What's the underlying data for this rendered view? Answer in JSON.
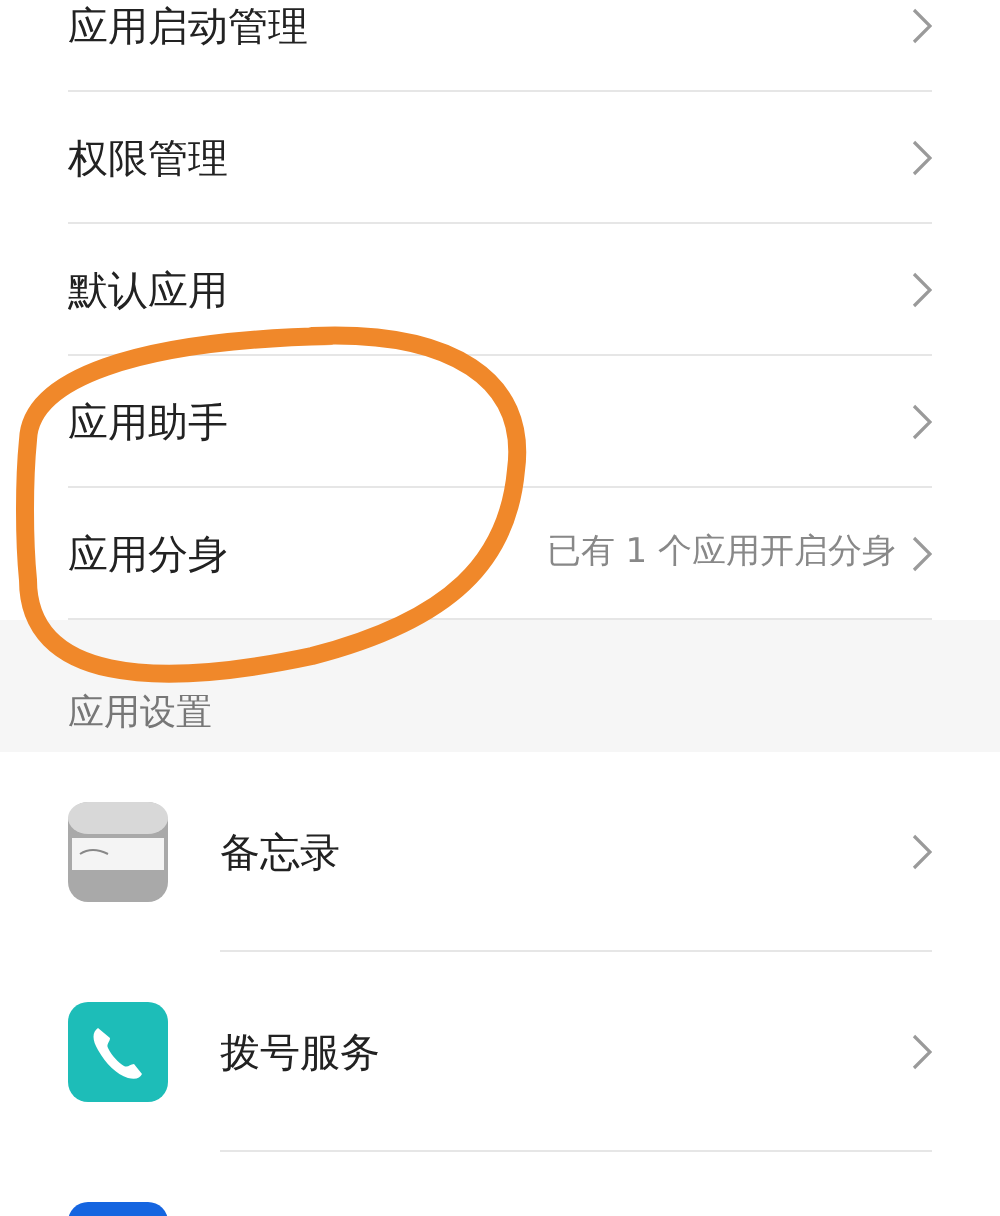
{
  "menu_items": [
    {
      "label": "应用启动管理"
    },
    {
      "label": "权限管理"
    },
    {
      "label": "默认应用"
    },
    {
      "label": "应用助手"
    },
    {
      "label": "应用分身",
      "value": "已有 1 个应用开启分身"
    }
  ],
  "app_settings": {
    "header": "应用设置",
    "apps": [
      {
        "kind": "notes",
        "label": "备忘录"
      },
      {
        "kind": "phone",
        "label": "拨号服务"
      },
      {
        "kind": "blue"
      }
    ]
  }
}
